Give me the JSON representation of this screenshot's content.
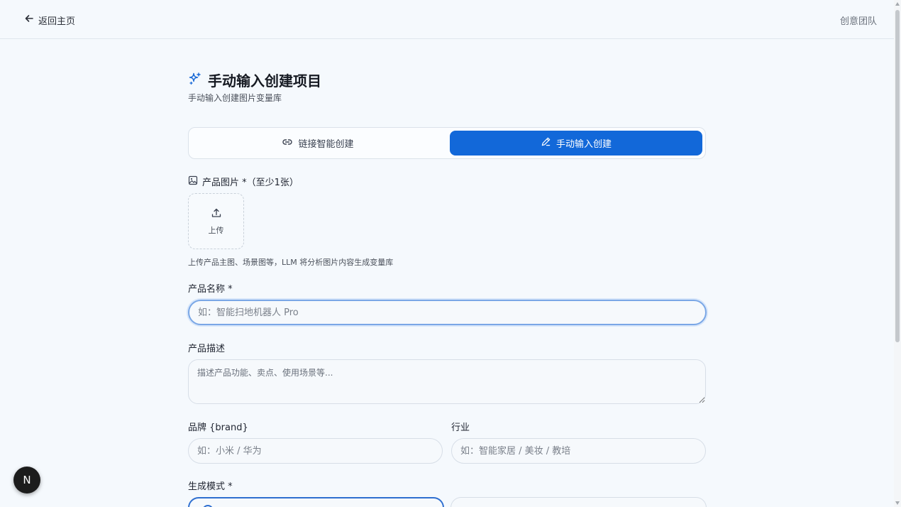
{
  "header": {
    "back_label": "返回主页",
    "team_label": "创意团队"
  },
  "page": {
    "title": "手动输入创建项目",
    "subtitle": "手动输入创建图片变量库"
  },
  "tabs": {
    "link_label": "链接智能创建",
    "manual_label": "手动输入创建",
    "active": "manual"
  },
  "images": {
    "label": "产品图片 *（至少1张）",
    "upload_label": "上传",
    "hint": "上传产品主图、场景图等，LLM 将分析图片内容生成变量库"
  },
  "fields": {
    "name_label": "产品名称 *",
    "name_placeholder": "如：智能扫地机器人 Pro",
    "desc_label": "产品描述",
    "desc_placeholder": "描述产品功能、卖点、使用场景等...",
    "brand_label": "品牌 {brand}",
    "brand_placeholder": "如：小米 / 华为",
    "industry_label": "行业",
    "industry_placeholder": "如：智能家居 / 美妆 / 教培",
    "mode_label": "生成模式 *"
  },
  "badge": {
    "letter": "N"
  },
  "colors": {
    "accent": "#1268d9",
    "background": "#f5f9fd",
    "focus_ring": "#7aa7e6"
  }
}
